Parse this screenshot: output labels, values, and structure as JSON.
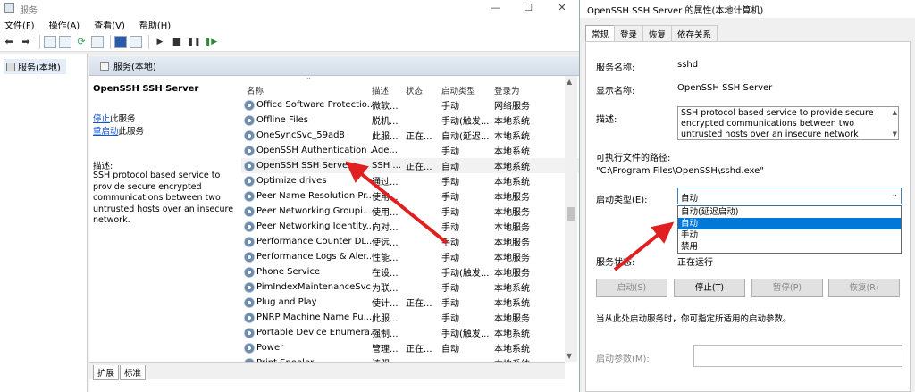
{
  "window": {
    "title": "服务",
    "min": "—",
    "max": "☐",
    "close": "✕"
  },
  "menu": [
    "文件(F)",
    "操作(A)",
    "查看(V)",
    "帮助(H)"
  ],
  "tree": {
    "root": "服务(本地)"
  },
  "panel_header": "服务(本地)",
  "detail": {
    "name": "OpenSSH SSH Server",
    "stop_link": "停止",
    "stop_suffix": "此服务",
    "restart_link": "重启动",
    "restart_suffix": "此服务",
    "desc_label": "描述:",
    "desc_text": "SSH protocol based service to provide secure encrypted communications between two untrusted hosts over an insecure network."
  },
  "columns": {
    "name": "名称",
    "desc": "描述",
    "status": "状态",
    "startup": "启动类型",
    "logon": "登录为"
  },
  "services": [
    {
      "name": "Office Software Protectio...",
      "desc": "微软...",
      "status": "",
      "startup": "手动",
      "logon": "网络服务"
    },
    {
      "name": "Offline Files",
      "desc": "脱机...",
      "status": "",
      "startup": "手动(触发...",
      "logon": "本地系统"
    },
    {
      "name": "OneSyncSvc_59ad8",
      "desc": "此服...",
      "status": "正在...",
      "startup": "自动(延迟...",
      "logon": "本地系统"
    },
    {
      "name": "OpenSSH Authentication ...",
      "desc": "Age...",
      "status": "",
      "startup": "手动",
      "logon": "本地系统"
    },
    {
      "name": "OpenSSH SSH Server",
      "desc": "SSH ...",
      "status": "正在...",
      "startup": "自动",
      "logon": "本地系统"
    },
    {
      "name": "Optimize drives",
      "desc": "通过...",
      "status": "",
      "startup": "手动",
      "logon": "本地系统"
    },
    {
      "name": "Peer Name Resolution Pr...",
      "desc": "使用...",
      "status": "",
      "startup": "手动",
      "logon": "本地服务"
    },
    {
      "name": "Peer Networking Groupi...",
      "desc": "使用...",
      "status": "",
      "startup": "手动",
      "logon": "本地服务"
    },
    {
      "name": "Peer Networking Identity...",
      "desc": "向对...",
      "status": "",
      "startup": "手动",
      "logon": "本地服务"
    },
    {
      "name": "Performance Counter DL...",
      "desc": "使远...",
      "status": "",
      "startup": "手动",
      "logon": "本地服务"
    },
    {
      "name": "Performance Logs & Aler...",
      "desc": "性能...",
      "status": "",
      "startup": "手动",
      "logon": "本地服务"
    },
    {
      "name": "Phone Service",
      "desc": "在设...",
      "status": "",
      "startup": "手动(触发...",
      "logon": "本地服务"
    },
    {
      "name": "PimIndexMaintenanceSvc...",
      "desc": "为联...",
      "status": "",
      "startup": "手动",
      "logon": "本地系统"
    },
    {
      "name": "Plug and Play",
      "desc": "使计...",
      "status": "正在...",
      "startup": "手动",
      "logon": "本地系统"
    },
    {
      "name": "PNRP Machine Name Pu...",
      "desc": "此服...",
      "status": "",
      "startup": "手动",
      "logon": "本地服务"
    },
    {
      "name": "Portable Device Enumera...",
      "desc": "强制...",
      "status": "",
      "startup": "手动(触发...",
      "logon": "本地系统"
    },
    {
      "name": "Power",
      "desc": "管理...",
      "status": "正在...",
      "startup": "自动",
      "logon": "本地系统"
    },
    {
      "name": "Print Spooler",
      "desc": "该服...",
      "status": "",
      "startup": "",
      "logon": "本地系统"
    }
  ],
  "bottom_tabs": [
    "扩展",
    "标准"
  ],
  "dialog": {
    "title": "OpenSSH SSH Server 的属性(本地计算机)",
    "tabs": [
      "常规",
      "登录",
      "恢复",
      "依存关系"
    ],
    "service_name_label": "服务名称:",
    "service_name": "sshd",
    "display_name_label": "显示名称:",
    "display_name": "OpenSSH SSH Server",
    "desc_label": "描述:",
    "desc_text": "SSH protocol based service to provide secure encrypted communications between two untrusted hosts over an insecure network",
    "path_label": "可执行文件的路径:",
    "path": "\"C:\\Program Files\\OpenSSH\\sshd.exe\"",
    "startup_label": "启动类型(E):",
    "startup_value": "自动",
    "startup_options": [
      "自动(延迟启动)",
      "自动",
      "手动",
      "禁用"
    ],
    "status_label": "服务状态:",
    "status_value": "正在运行",
    "btn_start": "启动(S)",
    "btn_stop": "停止(T)",
    "btn_pause": "暂停(P)",
    "btn_resume": "恢复(R)",
    "hint": "当从此处启动服务时，你可指定所适用的启动参数。",
    "param_label": "启动参数(M):"
  }
}
